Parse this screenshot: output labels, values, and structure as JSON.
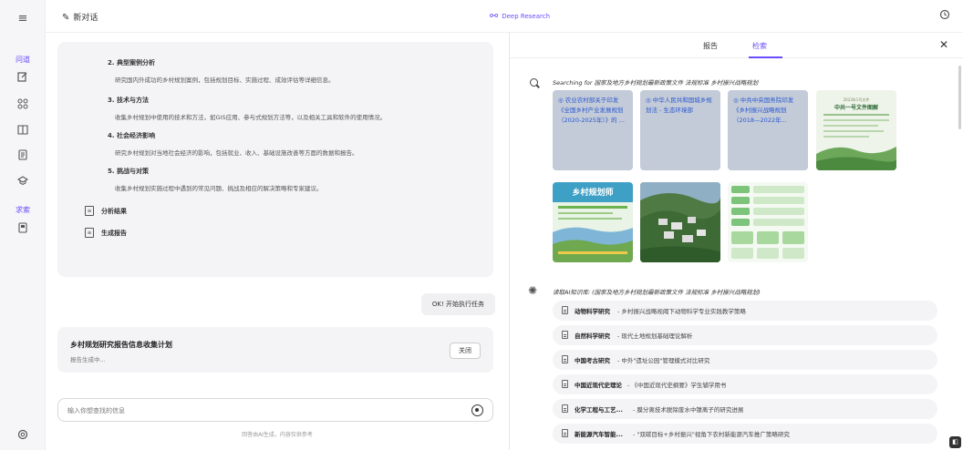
{
  "rail": {
    "menu_icon": "≡",
    "section_qa": "问道",
    "section_search": "求索"
  },
  "header": {
    "new_chat": "新对话",
    "deep_research": "Deep Research"
  },
  "plan": {
    "steps": [
      {
        "title": "2. 典型案例分析",
        "desc": "研究国内外成功的乡村规划案例，包括规划目标、实施过程、成效评估等详细信息。"
      },
      {
        "title": "3. 技术与方法",
        "desc": "收集乡村规划中使用的技术和方法，如GIS应用、参与式规划方法等，以及相关工具和软件的使用情况。"
      },
      {
        "title": "4. 社会经济影响",
        "desc": "研究乡村规划对当地社会经济的影响，包括就业、收入、基础设施改善等方面的数据和报告。"
      },
      {
        "title": "5. 挑战与对策",
        "desc": "收集乡村规划实施过程中遇到的常见问题、挑战及相应的解决策略和专家建议。"
      }
    ],
    "actions": [
      "分析结果",
      "生成报告"
    ]
  },
  "bubble": "OK! 开始执行任务",
  "card": {
    "title": "乡村规划研究报告信息收集计划",
    "status": "报告生成中...",
    "close": "关闭"
  },
  "input": {
    "placeholder": "输入你想查找的信息"
  },
  "disclaimer": "回答由AI生成，内容仅供参考",
  "panel": {
    "tab_report": "报告",
    "tab_search": "检索",
    "search_prefix": "Searching for ",
    "search_query": "国家及地方乡村规划最新政策文件 法规标准 乡村振兴战略规划",
    "results": [
      {
        "text": "◎ 农业农村部关于印发《全国乡村产业发展规划（2020-2025年）》的 ..."
      },
      {
        "text": "◎ 中华人民共和国城乡规划法 - 生态环境部"
      },
      {
        "text": "◎ 中共中央国务院印发《乡村振兴战略规划（2018—2022年..."
      }
    ],
    "image_results": {
      "poster_title": "中共一号文件图解",
      "poster_header": "2023年1号文件",
      "planner_title": "乡村规划师"
    },
    "kb_prefix": "读取AI知识库: ",
    "kb_query": "(国家及地方乡村规划最新政策文件 法规标准 乡村振兴战略规划)",
    "kb_items": [
      {
        "title": "动物科学研究",
        "desc": " - 乡村振兴战略视阈下动物科学专业实践教学策略"
      },
      {
        "title": "自然科学研究",
        "desc": " - 现代土地规划基础理论解析"
      },
      {
        "title": "中国考古研究",
        "desc": " - 中外\"遗址公园\"管理模式对比研究"
      },
      {
        "title": "中国近现代史理论",
        "desc": " - 《中国近现代史纲要》学生辅学用书"
      },
      {
        "title": "化学工程与工艺...",
        "desc": " - 膜分离技术脱除废水中镍离子的研究进展"
      },
      {
        "title": "新能源汽车智能...",
        "desc": " - \"双碳目标+乡村振兴\"视角下农村新能源汽车推广策略研究"
      }
    ]
  },
  "colors": {
    "accent": "#6a4cff",
    "bubble_bg": "#f0f0f3",
    "card_bg": "#f4f4f6"
  }
}
